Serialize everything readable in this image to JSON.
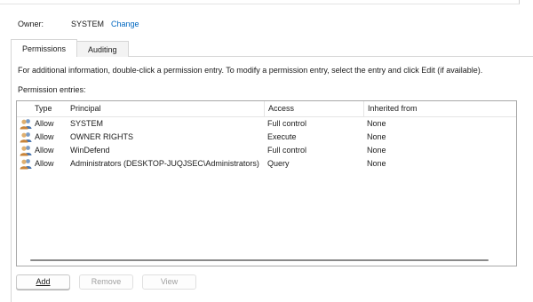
{
  "owner": {
    "label": "Owner:",
    "value": "SYSTEM",
    "change_link": "Change"
  },
  "tabs": [
    {
      "label": "Permissions",
      "active": true
    },
    {
      "label": "Auditing",
      "active": false
    }
  ],
  "info_text": "For additional information, double-click a permission entry. To modify a permission entry, select the entry and click Edit (if available).",
  "entries_label": "Permission entries:",
  "table": {
    "columns": [
      "Type",
      "Principal",
      "Access",
      "Inherited from"
    ],
    "rows": [
      {
        "icon": "users-icon",
        "type": "Allow",
        "principal": "SYSTEM",
        "access": "Full control",
        "inherited": "None"
      },
      {
        "icon": "users-icon",
        "type": "Allow",
        "principal": "OWNER RIGHTS",
        "access": "Execute",
        "inherited": "None"
      },
      {
        "icon": "users-icon",
        "type": "Allow",
        "principal": "WinDefend",
        "access": "Full control",
        "inherited": "None"
      },
      {
        "icon": "users-icon",
        "type": "Allow",
        "principal": "Administrators (DESKTOP-JUQJSEC\\Administrators)",
        "access": "Query",
        "inherited": "None"
      }
    ]
  },
  "buttons": {
    "add": "Add",
    "remove": "Remove",
    "view": "View"
  },
  "colors": {
    "link": "#0067c0",
    "border": "#a8a8a8",
    "disabled_text": "#a0a0a0"
  }
}
